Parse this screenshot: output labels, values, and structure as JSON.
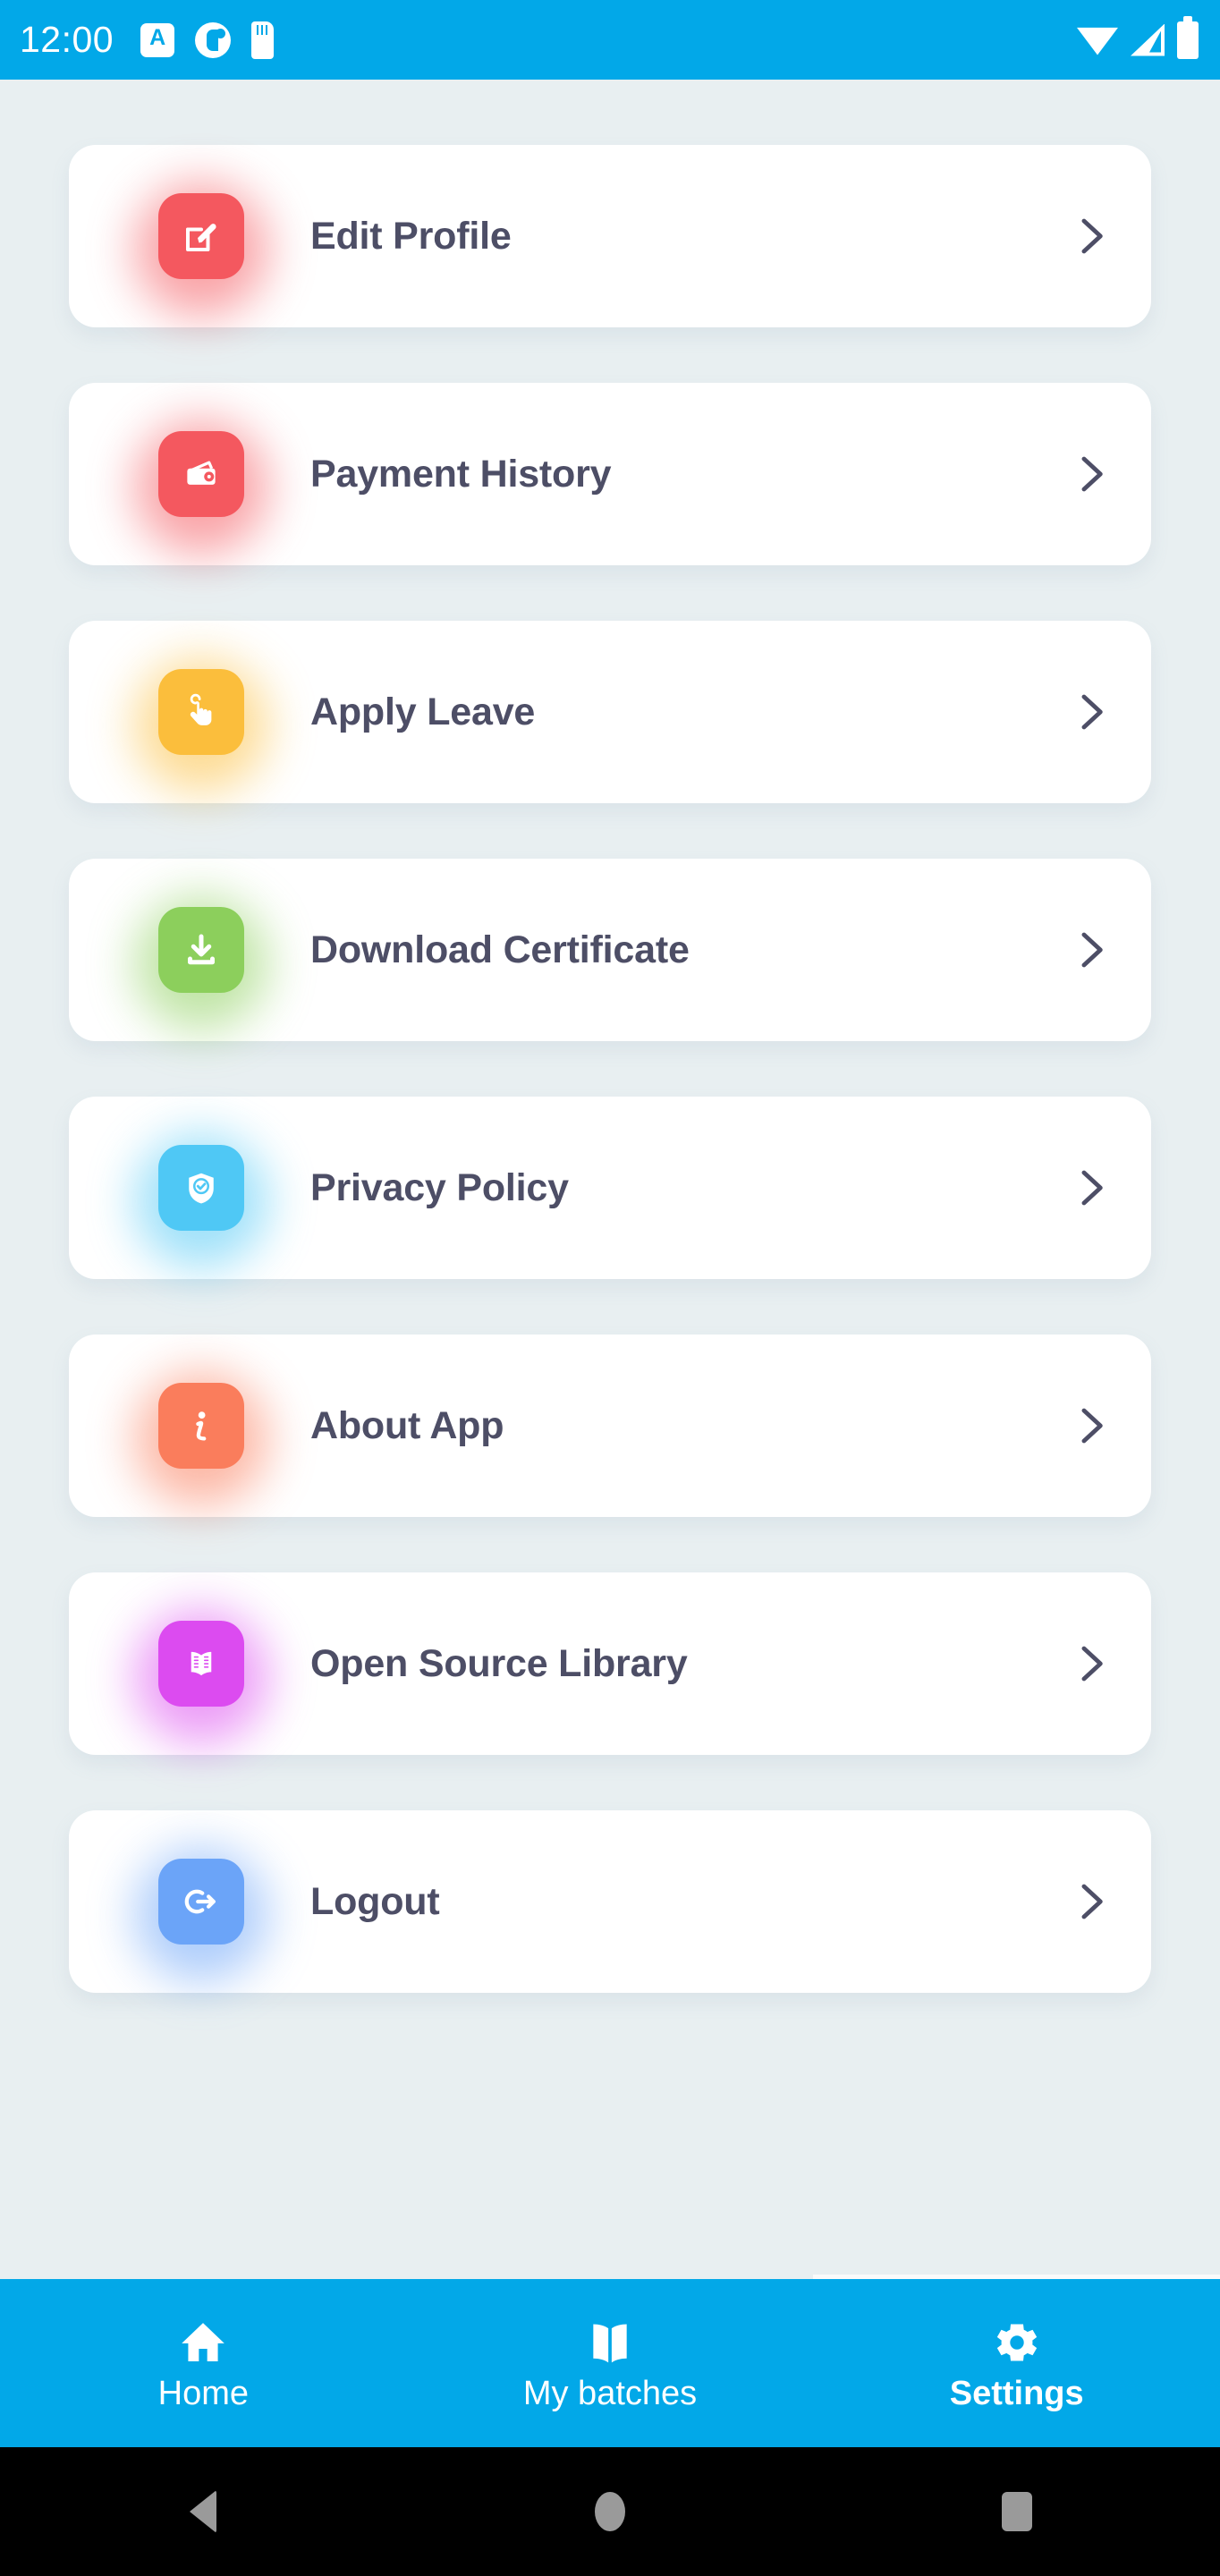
{
  "status_bar": {
    "time": "12:00",
    "background_color": "#02A8E8",
    "left_icons": [
      "keyboard-a-icon",
      "do-not-disturb-icon",
      "sd-card-icon"
    ],
    "right_icons": [
      "wifi-icon",
      "cellular-signal-icon",
      "battery-icon"
    ]
  },
  "theme": {
    "page_background": "#E8EFF1",
    "card_background": "#FFFFFF",
    "label_color": "#4D4E66",
    "accent": "#02A8E8"
  },
  "menu": {
    "items": [
      {
        "label": "Edit Profile",
        "icon": "edit-pencil-icon",
        "color": "#F4585F"
      },
      {
        "label": "Payment History",
        "icon": "wallet-icon",
        "color": "#F4585F"
      },
      {
        "label": "Apply Leave",
        "icon": "tap-hand-icon",
        "color": "#FBBE3C"
      },
      {
        "label": "Download Certificate",
        "icon": "download-icon",
        "color": "#8CCF5C"
      },
      {
        "label": "Privacy Policy",
        "icon": "shield-check-icon",
        "color": "#4FC8F5"
      },
      {
        "label": "About App",
        "icon": "info-icon",
        "color": "#FA7D5C"
      },
      {
        "label": "Open Source Library",
        "icon": "open-book-icon",
        "color": "#DC4BF0"
      },
      {
        "label": "Logout",
        "icon": "logout-arrow-icon",
        "color": "#6BA4F8"
      }
    ],
    "chevron_icon": "chevron-right-icon"
  },
  "bottom_nav": {
    "tabs": [
      {
        "label": "Home",
        "icon": "home-icon",
        "active": false
      },
      {
        "label": "My batches",
        "icon": "book-icon",
        "active": false
      },
      {
        "label": "Settings",
        "icon": "gear-icon",
        "active": true
      }
    ]
  },
  "android_nav": {
    "back": "back-triangle-icon",
    "home": "home-circle-icon",
    "recents": "recents-square-icon"
  }
}
